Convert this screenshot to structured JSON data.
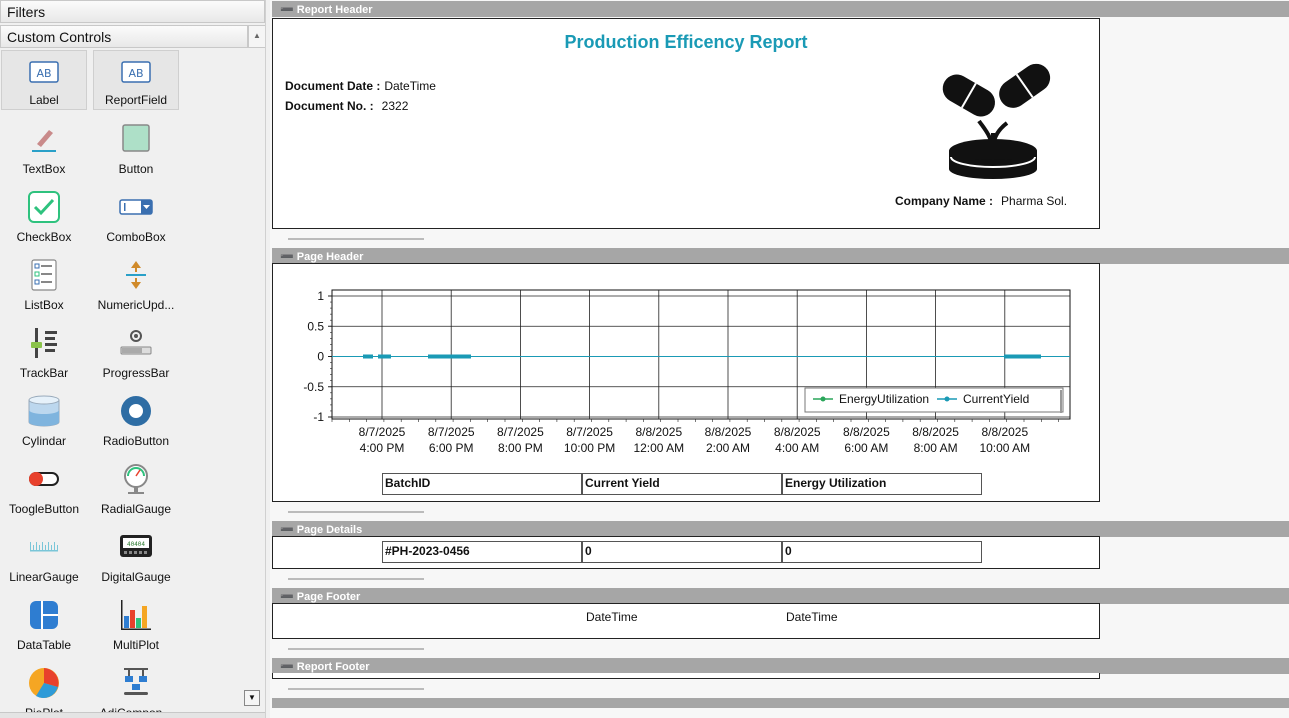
{
  "toolbox": {
    "filters_label": "Filters",
    "custom_controls_label": "Custom Controls",
    "scroll_up": "▲",
    "scroll_down": "▼",
    "tools": [
      {
        "label": "Label",
        "icon": "label-icon"
      },
      {
        "label": "ReportField",
        "icon": "report-field-icon"
      },
      {
        "label": "TextBox",
        "icon": "textbox-icon"
      },
      {
        "label": "Button",
        "icon": "button-icon"
      },
      {
        "label": "CheckBox",
        "icon": "checkbox-icon"
      },
      {
        "label": "ComboBox",
        "icon": "combobox-icon"
      },
      {
        "label": "ListBox",
        "icon": "listbox-icon"
      },
      {
        "label": "NumericUpd...",
        "icon": "numeric-updown-icon"
      },
      {
        "label": "TrackBar",
        "icon": "trackbar-icon"
      },
      {
        "label": "ProgressBar",
        "icon": "progressbar-icon"
      },
      {
        "label": "Cylindar",
        "icon": "cylinder-icon"
      },
      {
        "label": "RadioButton",
        "icon": "radiobutton-icon"
      },
      {
        "label": "ToogleButton",
        "icon": "toggle-button-icon"
      },
      {
        "label": "RadialGauge",
        "icon": "radial-gauge-icon"
      },
      {
        "label": "LinearGauge",
        "icon": "linear-gauge-icon"
      },
      {
        "label": "DigitalGauge",
        "icon": "digital-gauge-icon"
      },
      {
        "label": "DataTable",
        "icon": "datatable-icon"
      },
      {
        "label": "MultiPlot",
        "icon": "multiplot-icon"
      },
      {
        "label": "PiePlot",
        "icon": "pieplot-icon"
      },
      {
        "label": "AdiCompon...",
        "icon": "adi-component-icon"
      }
    ],
    "digital_gauge_text": "40404"
  },
  "bands": {
    "report_header": "Report Header",
    "page_header": "Page Header",
    "page_details": "Page Details",
    "page_footer": "Page Footer",
    "report_footer": "Report Footer",
    "collapse_glyph": "➖"
  },
  "report_header": {
    "title": "Production Efficency Report",
    "document_date_label": "Document Date :",
    "document_date_value": "DateTime",
    "document_no_label": "Document No. :",
    "document_no_value": "2322",
    "company_name_label": "Company Name :",
    "company_name_value": "Pharma Sol.",
    "logo_icon": "pills-plant-logo"
  },
  "chart_data": {
    "type": "line",
    "y_ticks": [
      "1",
      "0.5",
      "0",
      "-0.5",
      "-1"
    ],
    "ylim": [
      -1,
      1
    ],
    "x_ticks": [
      [
        "8/7/2025",
        "4:00 PM"
      ],
      [
        "8/7/2025",
        "6:00 PM"
      ],
      [
        "8/7/2025",
        "8:00 PM"
      ],
      [
        "8/7/2025",
        "10:00 PM"
      ],
      [
        "8/8/2025",
        "12:00 AM"
      ],
      [
        "8/8/2025",
        "2:00 AM"
      ],
      [
        "8/8/2025",
        "4:00 AM"
      ],
      [
        "8/8/2025",
        "6:00 AM"
      ],
      [
        "8/8/2025",
        "8:00 AM"
      ],
      [
        "8/8/2025",
        "10:00 AM"
      ]
    ],
    "series": [
      {
        "name": "EnergyUtilization",
        "color": "#2aa65a",
        "value": 0
      },
      {
        "name": "CurrentYield",
        "color": "#1a9ab5",
        "value": 0
      }
    ],
    "legend_position": "bottom-right",
    "grid": true
  },
  "page_header": {
    "columns": [
      "BatchID",
      "Current Yield",
      "Energy Utilization"
    ]
  },
  "page_details": {
    "row": [
      "#PH-2023-0456",
      "0",
      "0"
    ]
  },
  "page_footer": {
    "left": "DateTime",
    "right": "DateTime"
  }
}
